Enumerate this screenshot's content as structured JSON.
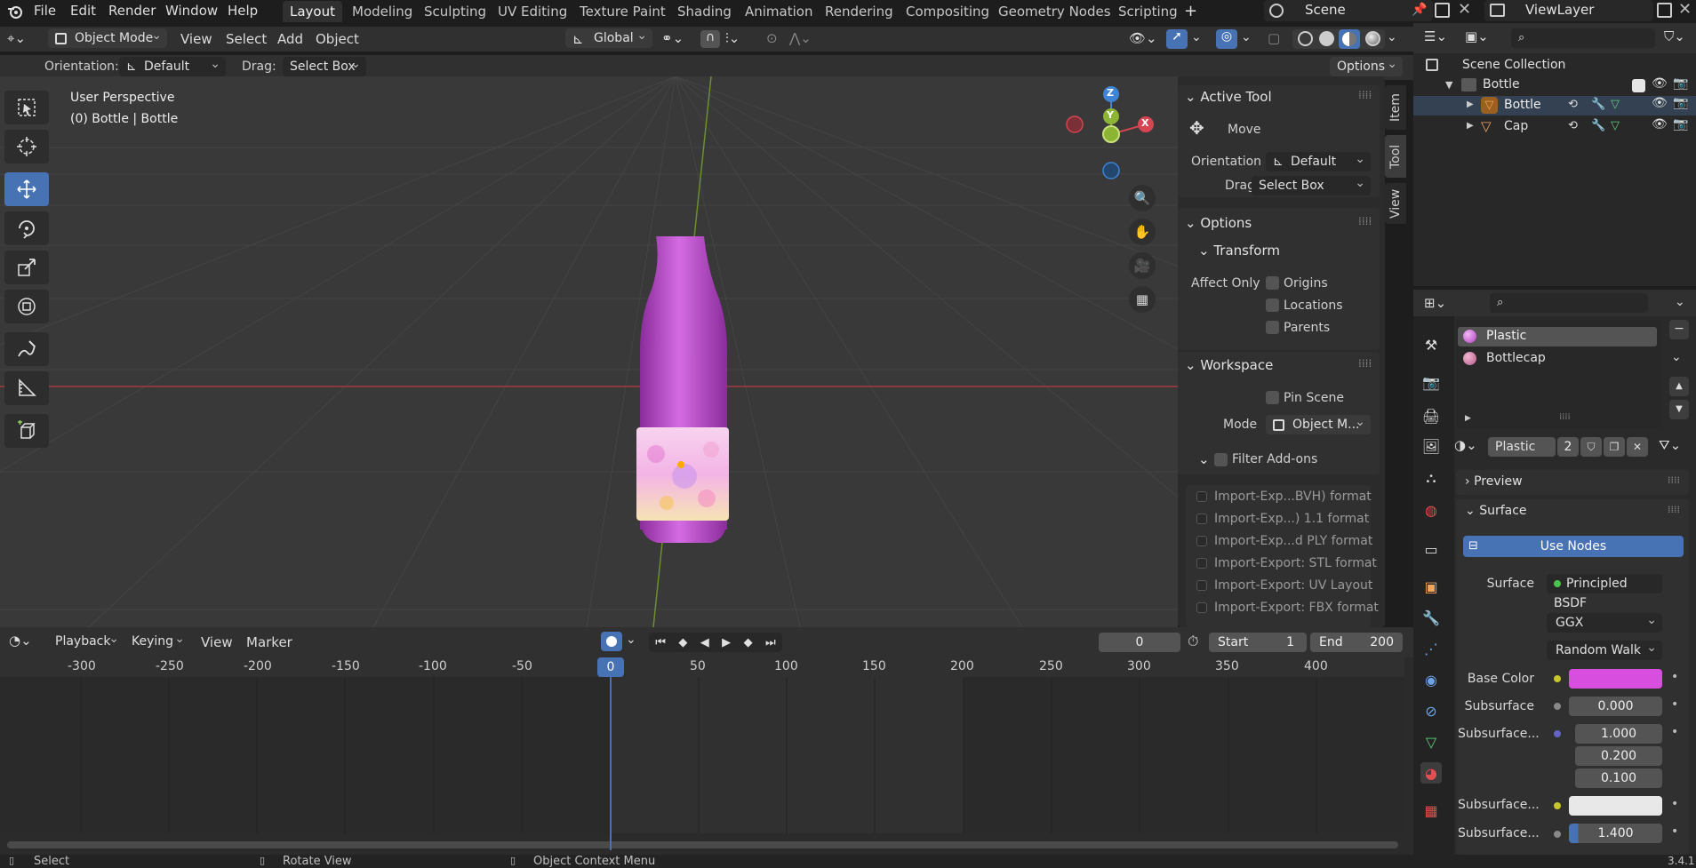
{
  "menus": [
    "File",
    "Edit",
    "Render",
    "Window",
    "Help"
  ],
  "workspaces": [
    "Layout",
    "Modeling",
    "Sculpting",
    "UV Editing",
    "Texture Paint",
    "Shading",
    "Animation",
    "Rendering",
    "Compositing",
    "Geometry Nodes",
    "Scripting"
  ],
  "scene": {
    "name": "Scene",
    "view_layer": "ViewLayer"
  },
  "header": {
    "mode": "Object Mode",
    "menus": [
      "View",
      "Select",
      "Add",
      "Object"
    ],
    "transform_orientation": "Global",
    "orientation_label": "Orientation:",
    "orientation_value": "Default",
    "drag_label": "Drag:",
    "drag_value": "Select Box",
    "options_label": "Options"
  },
  "viewport": {
    "perspective": "User Perspective",
    "object_info": "(0) Bottle | Bottle",
    "axes": {
      "z": "Z",
      "y": "Y",
      "x": "X"
    }
  },
  "npanel": {
    "active_tool_title": "Active Tool",
    "tool_name": "Move",
    "orientation_label": "Orientation",
    "orientation_value": "Default",
    "drag_label": "Drag:",
    "drag_value": "Select Box",
    "options_title": "Options",
    "transform_title": "Transform",
    "affect_only_label": "Affect Only",
    "affect_only": [
      "Origins",
      "Locations",
      "Parents"
    ],
    "workspace_title": "Workspace",
    "pin_scene": "Pin Scene",
    "mode_label": "Mode",
    "mode_value": "Object M...",
    "filter_addons": "Filter Add-ons",
    "addons": [
      "Import-Exp...BVH) format",
      "Import-Exp...) 1.1 format",
      "Import-Exp...d PLY format",
      "Import-Export: STL format",
      "Import-Export: UV Layout",
      "Import-Export: FBX format"
    ],
    "tabs": [
      "Item",
      "Tool",
      "View"
    ]
  },
  "timeline": {
    "menus": [
      "Playback",
      "Keying",
      "View",
      "Marker"
    ],
    "current_frame": "0",
    "start_label": "Start",
    "start_value": "1",
    "end_label": "End",
    "end_value": "200",
    "ticks": [
      "-300",
      "-250",
      "-200",
      "-150",
      "-100",
      "-50",
      "0",
      "50",
      "100",
      "150",
      "200",
      "250",
      "300",
      "350",
      "400"
    ]
  },
  "outliner": {
    "root": "Scene Collection",
    "collection": "Bottle",
    "objects": [
      "Bottle",
      "Cap"
    ]
  },
  "properties": {
    "materials": [
      "Plastic",
      "Bottlecap"
    ],
    "material_name": "Plastic",
    "users": "2",
    "preview_label": "Preview",
    "surface_label": "Surface",
    "use_nodes": "Use Nodes",
    "surface_field_label": "Surface",
    "surface_shader": "Principled BSDF",
    "distribution": "GGX",
    "subsurface_method": "Random Walk",
    "base_color_label": "Base Color",
    "base_color": "#d84fe0",
    "subsurface_label": "Subsurface",
    "subsurface_value": "0.000",
    "subsurface_radius_label": "Subsurface...",
    "subsurface_radius": [
      "1.000",
      "0.200",
      "0.100"
    ],
    "subsurface_color_label": "Subsurface...",
    "subsurface_ior_label": "Subsurface...",
    "subsurface_ior": "1.400"
  },
  "status": {
    "select": "Select",
    "rotate": "Rotate View",
    "context": "Object Context Menu",
    "version": "3.4.1"
  },
  "colors": {
    "accent": "#4772b3",
    "bottle": "#c24fd0",
    "axis_x": "#d64552",
    "axis_y": "#8cb534",
    "axis_z": "#3d84d6"
  }
}
